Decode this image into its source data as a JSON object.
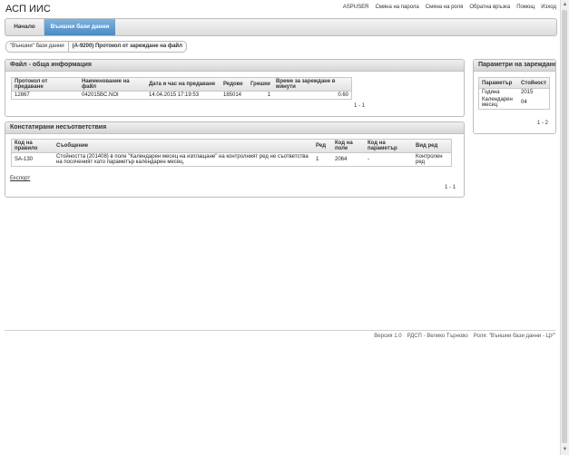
{
  "app": {
    "title": "АСП ИИС"
  },
  "top_links": [
    "ASPUSER",
    "Смяна на парола",
    "Смяна на роля",
    "Обратна връзка",
    "Помощ",
    "Изход"
  ],
  "nav": {
    "home": "Начало",
    "active": "Външни бази данни"
  },
  "breadcrumb": [
    "\"Външни\" бази данни",
    "(А-9200) Протокол от зареждане на файл"
  ],
  "file_panel": {
    "title": "Файл - обща информация",
    "headers": [
      "Протокол от предаване",
      "Наименование на файл",
      "Дата и час на предаване",
      "Редове",
      "Грешки",
      "Време за зареждане в минути"
    ],
    "row": [
      "12867",
      "042015BC.NOI",
      "14.04.2015 17:19:53",
      "185014",
      "1",
      "0.60"
    ],
    "pager": "1 - 1"
  },
  "params_panel": {
    "title": "Параметри на зареждане",
    "headers": [
      "Параметър",
      "Стойност"
    ],
    "rows": [
      [
        "Година",
        "2015"
      ],
      [
        "Календарен месец",
        "04"
      ]
    ],
    "pager": "1 - 2"
  },
  "issues_panel": {
    "title": "Констатирани несъответствия",
    "headers": [
      "Код на правило",
      "Съобщение",
      "Ред",
      "Код на поле",
      "Код на параметър",
      "Вид ред"
    ],
    "row": [
      "SA-130",
      "Стойността (201408) в поле \"Календарен месец на изплащане\" на контролният ред не съответства на посоченият като параметър календарен месец.",
      "1",
      "2064",
      "-",
      "Контролен ред"
    ],
    "export": "Експорт",
    "pager": "1 - 1"
  },
  "footer": [
    "Версия 1.0",
    "РДСП - Велико Търново",
    "Роля: \"Външни бази данни - ЦУ\""
  ]
}
